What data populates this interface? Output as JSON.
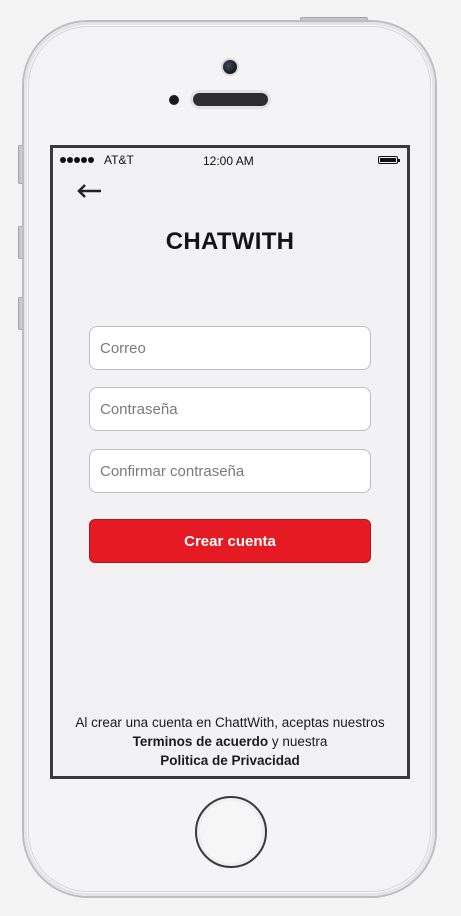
{
  "status_bar": {
    "carrier": "AT&T",
    "time": "12:00 AM"
  },
  "header": {
    "back_icon": "arrow-left-icon"
  },
  "app": {
    "title": "CHATWITH"
  },
  "form": {
    "email_placeholder": "Correo",
    "password_placeholder": "Contraseña",
    "confirm_password_placeholder": "Confirmar contraseña",
    "submit_label": "Crear cuenta"
  },
  "terms": {
    "text_before": "Al crear una cuenta en ChattWith, aceptas nuestros ",
    "terms_link": "Terminos de acuerdo",
    "text_middle": " y nuestra ",
    "privacy_link": "Politica de Privacidad"
  },
  "colors": {
    "accent": "#e51a23",
    "background": "#f2f2f4",
    "frame": "#3a3a3d"
  }
}
